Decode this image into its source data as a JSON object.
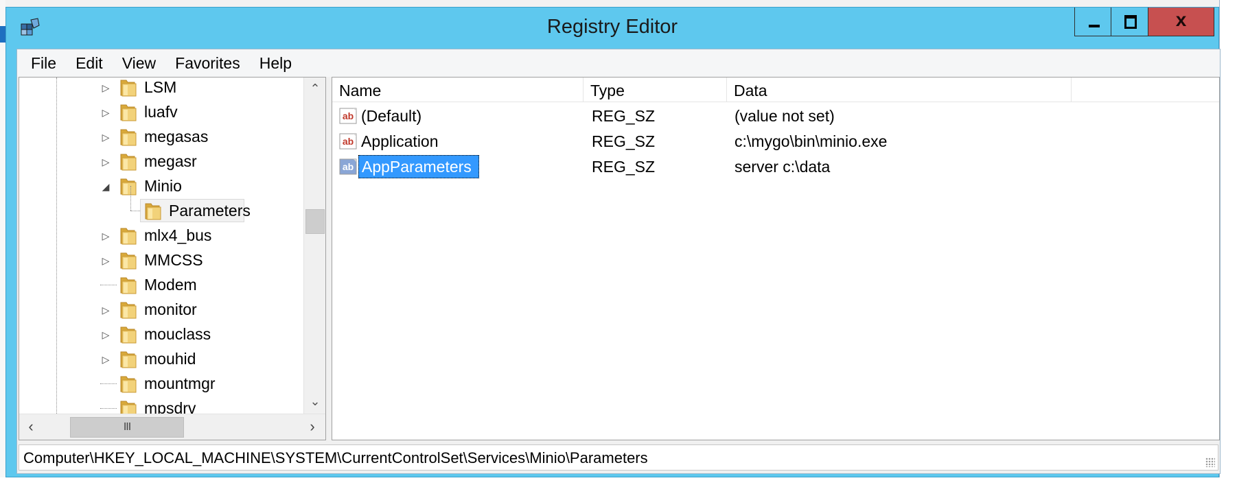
{
  "window": {
    "title": "Registry Editor",
    "close_glyph": "x"
  },
  "menu": [
    "File",
    "Edit",
    "View",
    "Favorites",
    "Help"
  ],
  "tree": {
    "items": [
      {
        "label": "LSM",
        "expander": "collapsed"
      },
      {
        "label": "luafv",
        "expander": "collapsed"
      },
      {
        "label": "megasas",
        "expander": "collapsed"
      },
      {
        "label": "megasr",
        "expander": "collapsed"
      },
      {
        "label": "Minio",
        "expander": "expanded"
      },
      {
        "label": "Parameters",
        "expander": "none",
        "child": true,
        "selected": true
      },
      {
        "label": "mlx4_bus",
        "expander": "collapsed"
      },
      {
        "label": "MMCSS",
        "expander": "collapsed"
      },
      {
        "label": "Modem",
        "expander": "none"
      },
      {
        "label": "monitor",
        "expander": "collapsed"
      },
      {
        "label": "mouclass",
        "expander": "collapsed"
      },
      {
        "label": "mouhid",
        "expander": "collapsed"
      },
      {
        "label": "mountmgr",
        "expander": "none"
      },
      {
        "label": "mpsdrv",
        "expander": "none"
      }
    ],
    "hscroll_thumb_glyph": "III"
  },
  "list": {
    "columns": [
      "Name",
      "Type",
      "Data"
    ],
    "rows": [
      {
        "icon": "string-value-icon",
        "name": "(Default)",
        "type": "REG_SZ",
        "data": "(value not set)",
        "selected": false
      },
      {
        "icon": "string-value-icon",
        "name": "Application",
        "type": "REG_SZ",
        "data": "c:\\mygo\\bin\\minio.exe",
        "selected": false
      },
      {
        "icon": "string-value-icon",
        "name": "AppParameters",
        "type": "REG_SZ",
        "data": "server c:\\data",
        "selected": true
      }
    ],
    "icon_glyph": "ab"
  },
  "status": {
    "path": "Computer\\HKEY_LOCAL_MACHINE\\SYSTEM\\CurrentControlSet\\Services\\Minio\\Parameters"
  },
  "colors": {
    "titlebar": "#5ec8ee",
    "close_button": "#c75050",
    "selection": "#3399ff",
    "folder": "#e8c15a"
  }
}
